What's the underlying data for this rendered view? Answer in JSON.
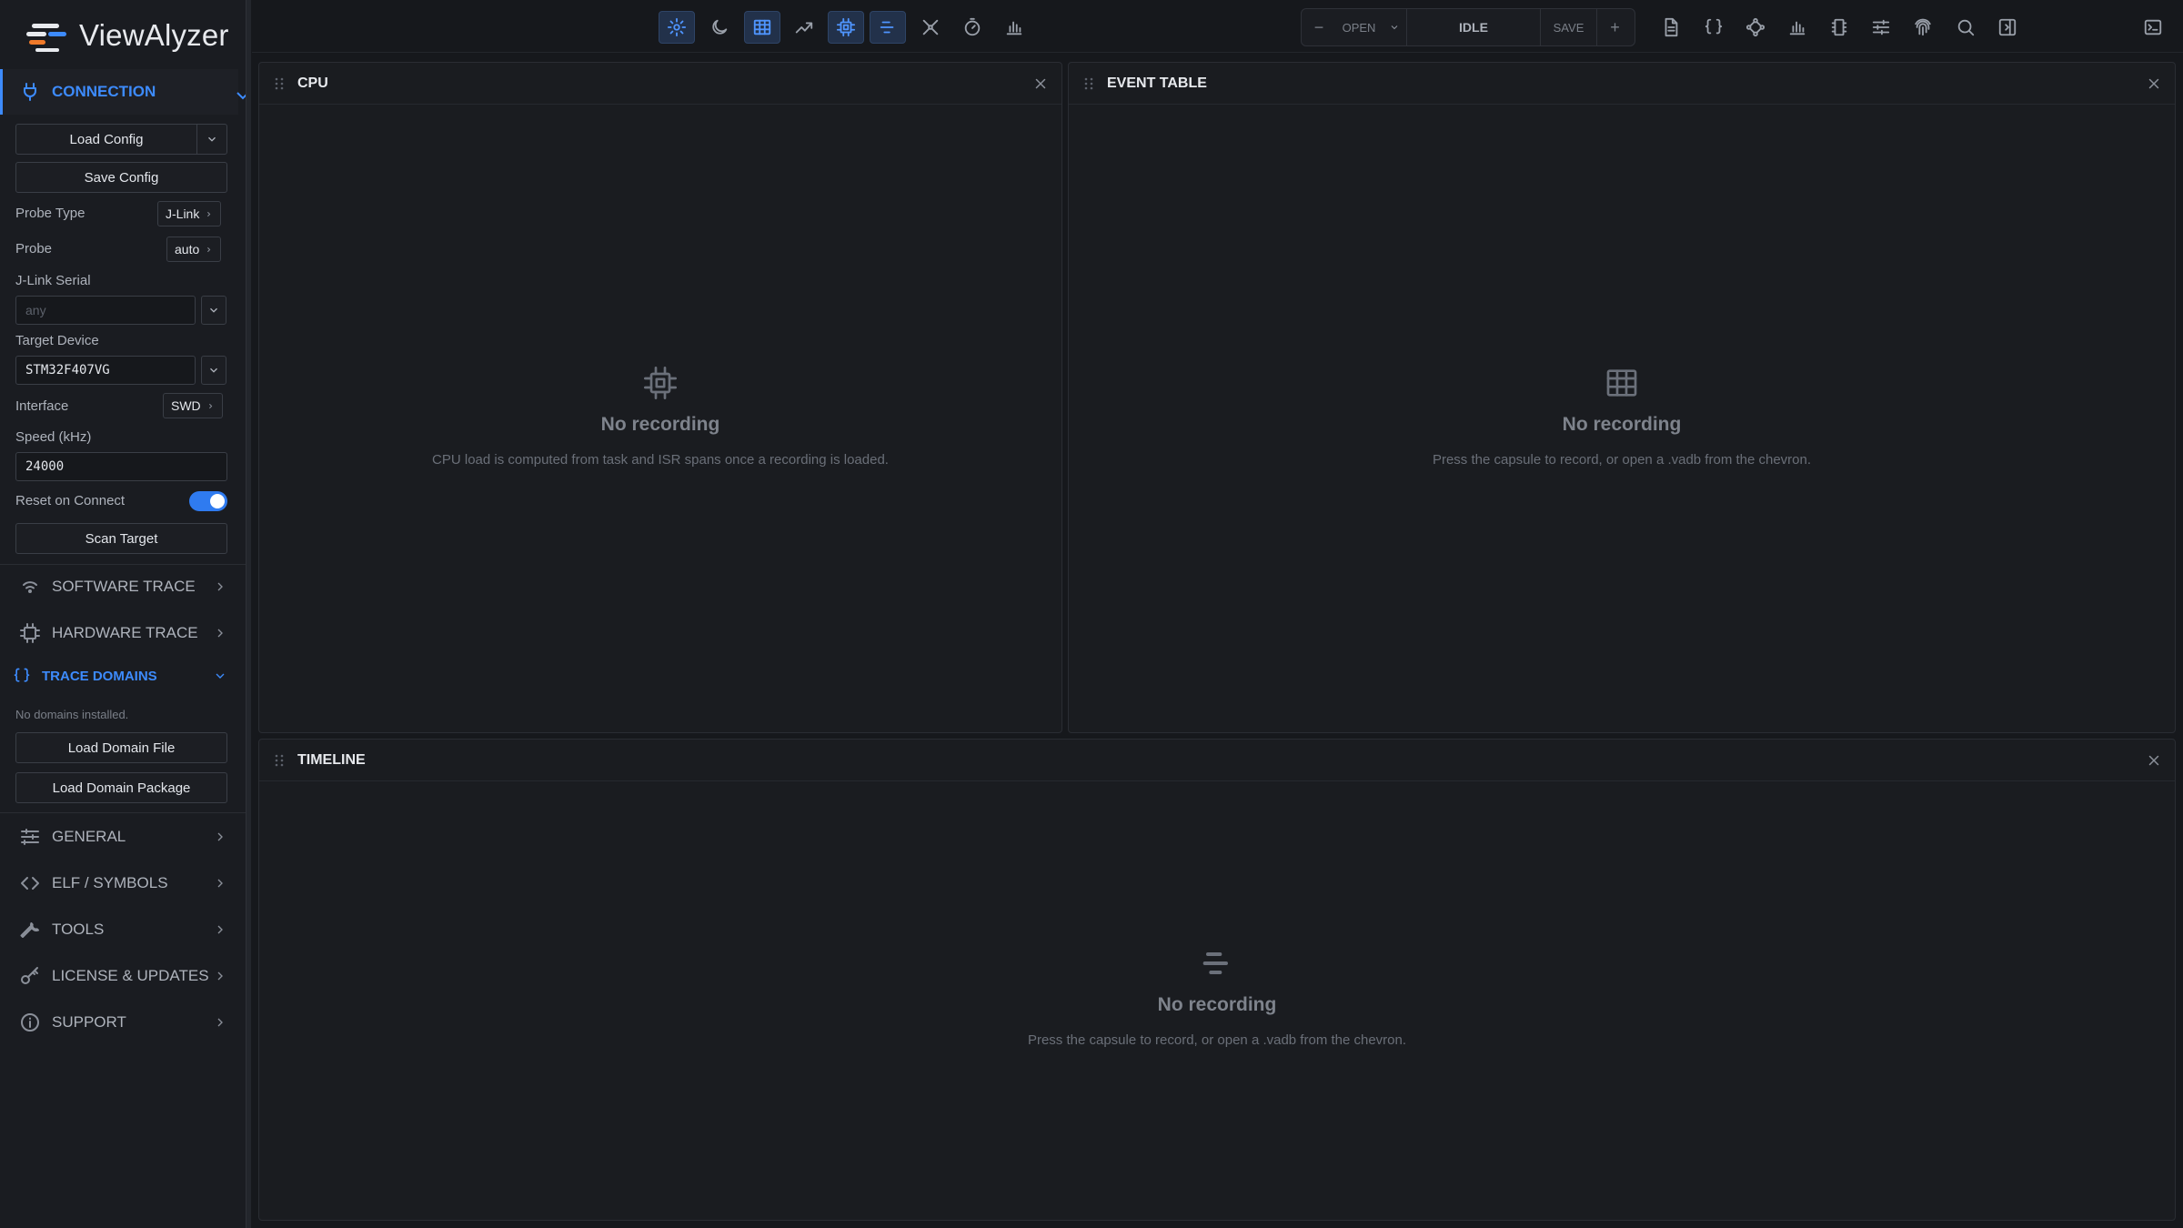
{
  "app": {
    "name": "ViewAlyzer"
  },
  "sidebar": {
    "connection": {
      "title": "CONNECTION",
      "load_config": "Load Config",
      "save_config": "Save Config",
      "probe_type_label": "Probe Type",
      "probe_type_value": "J-Link",
      "probe_label": "Probe",
      "probe_value": "auto",
      "jlink_serial_label": "J-Link Serial",
      "jlink_serial_placeholder": "any",
      "target_device_label": "Target Device",
      "target_device_value": "STM32F407VG",
      "interface_label": "Interface",
      "interface_value": "SWD",
      "speed_label": "Speed (kHz)",
      "speed_value": "24000",
      "reset_on_connect_label": "Reset on Connect",
      "reset_on_connect": true,
      "scan_target": "Scan Target"
    },
    "software_trace": "SOFTWARE TRACE",
    "hardware_trace": "HARDWARE TRACE",
    "trace_domains": {
      "title": "TRACE DOMAINS",
      "note": "No domains installed.",
      "load_domain_file": "Load Domain File",
      "load_domain_package": "Load Domain Package"
    },
    "general": "GENERAL",
    "elf_symbols": "ELF / SYMBOLS",
    "tools": "TOOLS",
    "license_updates": "LICENSE & UPDATES",
    "support": "SUPPORT"
  },
  "toolbar": {
    "left_icons": [
      "settings-icon",
      "moon-icon",
      "table-icon",
      "trend-icon",
      "cpu-icon",
      "timeline-icon",
      "graph-icon",
      "stopwatch-icon",
      "bar-chart-icon"
    ],
    "active_icons": [
      "settings-icon",
      "table-icon",
      "cpu-icon",
      "timeline-icon"
    ],
    "capsule": {
      "minus": "−",
      "open": "OPEN",
      "status": "IDLE",
      "save": "SAVE",
      "plus": "+"
    },
    "right_icons": [
      "document-icon",
      "braces-icon",
      "nodes-icon",
      "bar-chart-icon",
      "chip-icon",
      "sliders-icon",
      "fingerprint-icon",
      "search-icon",
      "panel-toggle-icon"
    ],
    "terminal_icon": "terminal-icon"
  },
  "panels": {
    "cpu": {
      "title": "CPU",
      "empty_title": "No recording",
      "empty_text": "CPU load is computed from task and ISR spans once a recording is loaded."
    },
    "event_table": {
      "title": "EVENT TABLE",
      "empty_title": "No recording",
      "empty_text": "Press the capsule to record, or open a .vadb from the chevron."
    },
    "timeline": {
      "title": "TIMELINE",
      "empty_title": "No recording",
      "empty_text": "Press the capsule to record, or open a .vadb from the chevron."
    }
  },
  "colors": {
    "accent": "#3d8bfd",
    "background": "#16181c",
    "panel": "#1a1c20",
    "logo_orange": "#f07a2a"
  }
}
